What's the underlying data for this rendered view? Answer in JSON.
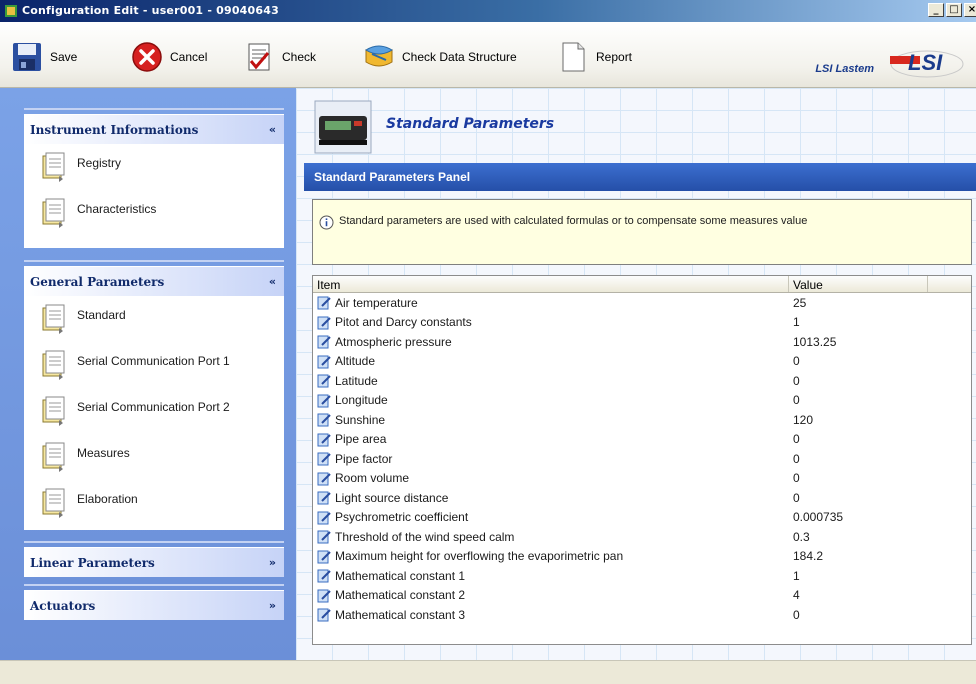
{
  "window": {
    "title": "Configuration Edit - user001 - 09040643",
    "controls": [
      "_",
      "□",
      "×"
    ]
  },
  "toolbar": {
    "save_label": "Save",
    "cancel_label": "Cancel",
    "check_label": "Check",
    "check_ds_label": "Check Data Structure",
    "report_label": "Report"
  },
  "brand": {
    "text": "LSI Lastem",
    "logo_text": "LSI"
  },
  "sidebar": {
    "groups": [
      {
        "title": "Instrument Informations",
        "expanded": true,
        "chevron": "«",
        "items": [
          {
            "label": "Registry"
          },
          {
            "label": "Characteristics"
          }
        ]
      },
      {
        "title": "General Parameters",
        "expanded": true,
        "chevron": "«",
        "items": [
          {
            "label": "Standard"
          },
          {
            "label": "Serial Communication Port 1"
          },
          {
            "label": "Serial Communication Port 2"
          },
          {
            "label": "Measures"
          },
          {
            "label": "Elaboration"
          }
        ]
      },
      {
        "title": "Linear Parameters",
        "expanded": false,
        "chevron": "»",
        "items": []
      },
      {
        "title": "Actuators",
        "expanded": false,
        "chevron": "»",
        "items": []
      }
    ]
  },
  "main": {
    "page_title": "Standard Parameters",
    "panel_title": "Standard Parameters Panel",
    "info_text": "Standard parameters are used with calculated formulas or to compensate some measures value",
    "table": {
      "columns": [
        "Item",
        "Value"
      ],
      "rows": [
        {
          "item": "Air temperature",
          "value": "25"
        },
        {
          "item": "Pitot and Darcy constants",
          "value": "1"
        },
        {
          "item": "Atmospheric pressure",
          "value": "1013.25"
        },
        {
          "item": "Altitude",
          "value": "0"
        },
        {
          "item": "Latitude",
          "value": "0"
        },
        {
          "item": "Longitude",
          "value": "0"
        },
        {
          "item": "Sunshine",
          "value": "120"
        },
        {
          "item": "Pipe area",
          "value": "0"
        },
        {
          "item": "Pipe factor",
          "value": "0"
        },
        {
          "item": "Room volume",
          "value": "0"
        },
        {
          "item": "Light source distance",
          "value": "0"
        },
        {
          "item": "Psychrometric coefficient",
          "value": "0.000735"
        },
        {
          "item": "Threshold of the wind speed calm",
          "value": "0.3"
        },
        {
          "item": "Maximum height for overflowing the evaporimetric pan",
          "value": "184.2"
        },
        {
          "item": "Mathematical constant 1",
          "value": "1"
        },
        {
          "item": "Mathematical constant 2",
          "value": "4"
        },
        {
          "item": "Mathematical constant 3",
          "value": "0"
        }
      ]
    }
  },
  "colors": {
    "accent": "#254fa8",
    "sidebar_bg": "#6b8fd8",
    "info_bg": "#ffffe1",
    "title_text": "#1a3aa0"
  }
}
